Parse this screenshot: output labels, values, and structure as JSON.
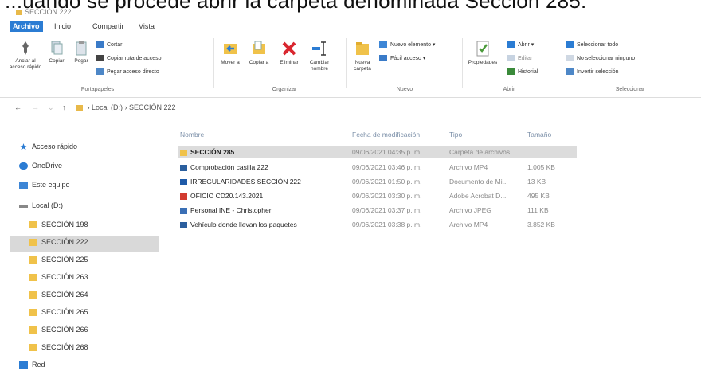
{
  "caption": "...uando se procede abrir la carpeta denominada Sección 285:",
  "title": "SECCIÓN 222",
  "tabs": [
    "Archivo",
    "Inicio",
    "Compartir",
    "Vista"
  ],
  "ribbon": {
    "portapapeles": {
      "label": "Portapapeles",
      "anclar": "Anclar al acceso rápido",
      "copiar": "Copiar",
      "pegar": "Pegar",
      "cortar": "Cortar",
      "copiar_ruta": "Copiar ruta de acceso",
      "pegar_acceso": "Pegar acceso directo"
    },
    "organizar": {
      "label": "Organizar",
      "mover": "Mover a",
      "copiar_a": "Copiar a",
      "eliminar": "Eliminar",
      "cambiar_nombre": "Cambiar nombre"
    },
    "nuevo": {
      "label": "Nuevo",
      "nueva_carpeta": "Nueva carpeta",
      "nuevo_elemento": "Nuevo elemento",
      "facil_acceso": "Fácil acceso"
    },
    "abrir": {
      "label": "Abrir",
      "propiedades": "Propiedades",
      "abrir": "Abrir",
      "editar": "Editar",
      "historial": "Historial"
    },
    "seleccionar": {
      "label": "Seleccionar",
      "todo": "Seleccionar todo",
      "ninguno": "No seleccionar ninguno",
      "invertir": "Invertir selección"
    }
  },
  "address": {
    "drive": "Local (D:)",
    "folder": "SECCIÓN 222"
  },
  "nav": {
    "acceso_rapido": "Acceso rápido",
    "onedrive": "OneDrive",
    "este_equipo": "Este equipo",
    "local": "Local (D:)",
    "folders": [
      "SECCIÓN 198",
      "SECCIÓN 222",
      "SECCIÓN 225",
      "SECCIÓN 263",
      "SECCIÓN 264",
      "SECCIÓN 265",
      "SECCIÓN 266",
      "SECCIÓN 268"
    ],
    "red": "Red"
  },
  "columns": {
    "name": "Nombre",
    "date": "Fecha de modificación",
    "type": "Tipo",
    "size": "Tamaño"
  },
  "files": [
    {
      "name": "SECCIÓN 285",
      "date": "09/06/2021 04:35 p. m.",
      "type": "Carpeta de archivos",
      "size": ""
    },
    {
      "name": "Comprobación casilla 222",
      "date": "09/06/2021 03:46 p. m.",
      "type": "Archivo MP4",
      "size": "1.005 KB"
    },
    {
      "name": "IRREGULARIDADES SECCIÓN 222",
      "date": "09/06/2021 01:50 p. m.",
      "type": "Documento de Mi...",
      "size": "13 KB"
    },
    {
      "name": "OFICIO CD20.143.2021",
      "date": "09/06/2021 03:30 p. m.",
      "type": "Adobe Acrobat D...",
      "size": "495 KB"
    },
    {
      "name": "Personal INE - Christopher",
      "date": "09/06/2021 03:37 p. m.",
      "type": "Archivo JPEG",
      "size": "111 KB"
    },
    {
      "name": "Vehículo donde llevan los paquetes",
      "date": "09/06/2021 03:38 p. m.",
      "type": "Archivo MP4",
      "size": "3.852 KB"
    }
  ],
  "colors": {
    "accent": "#2b7cd3",
    "folder": "#f0c24a",
    "delete": "#d9262f"
  }
}
